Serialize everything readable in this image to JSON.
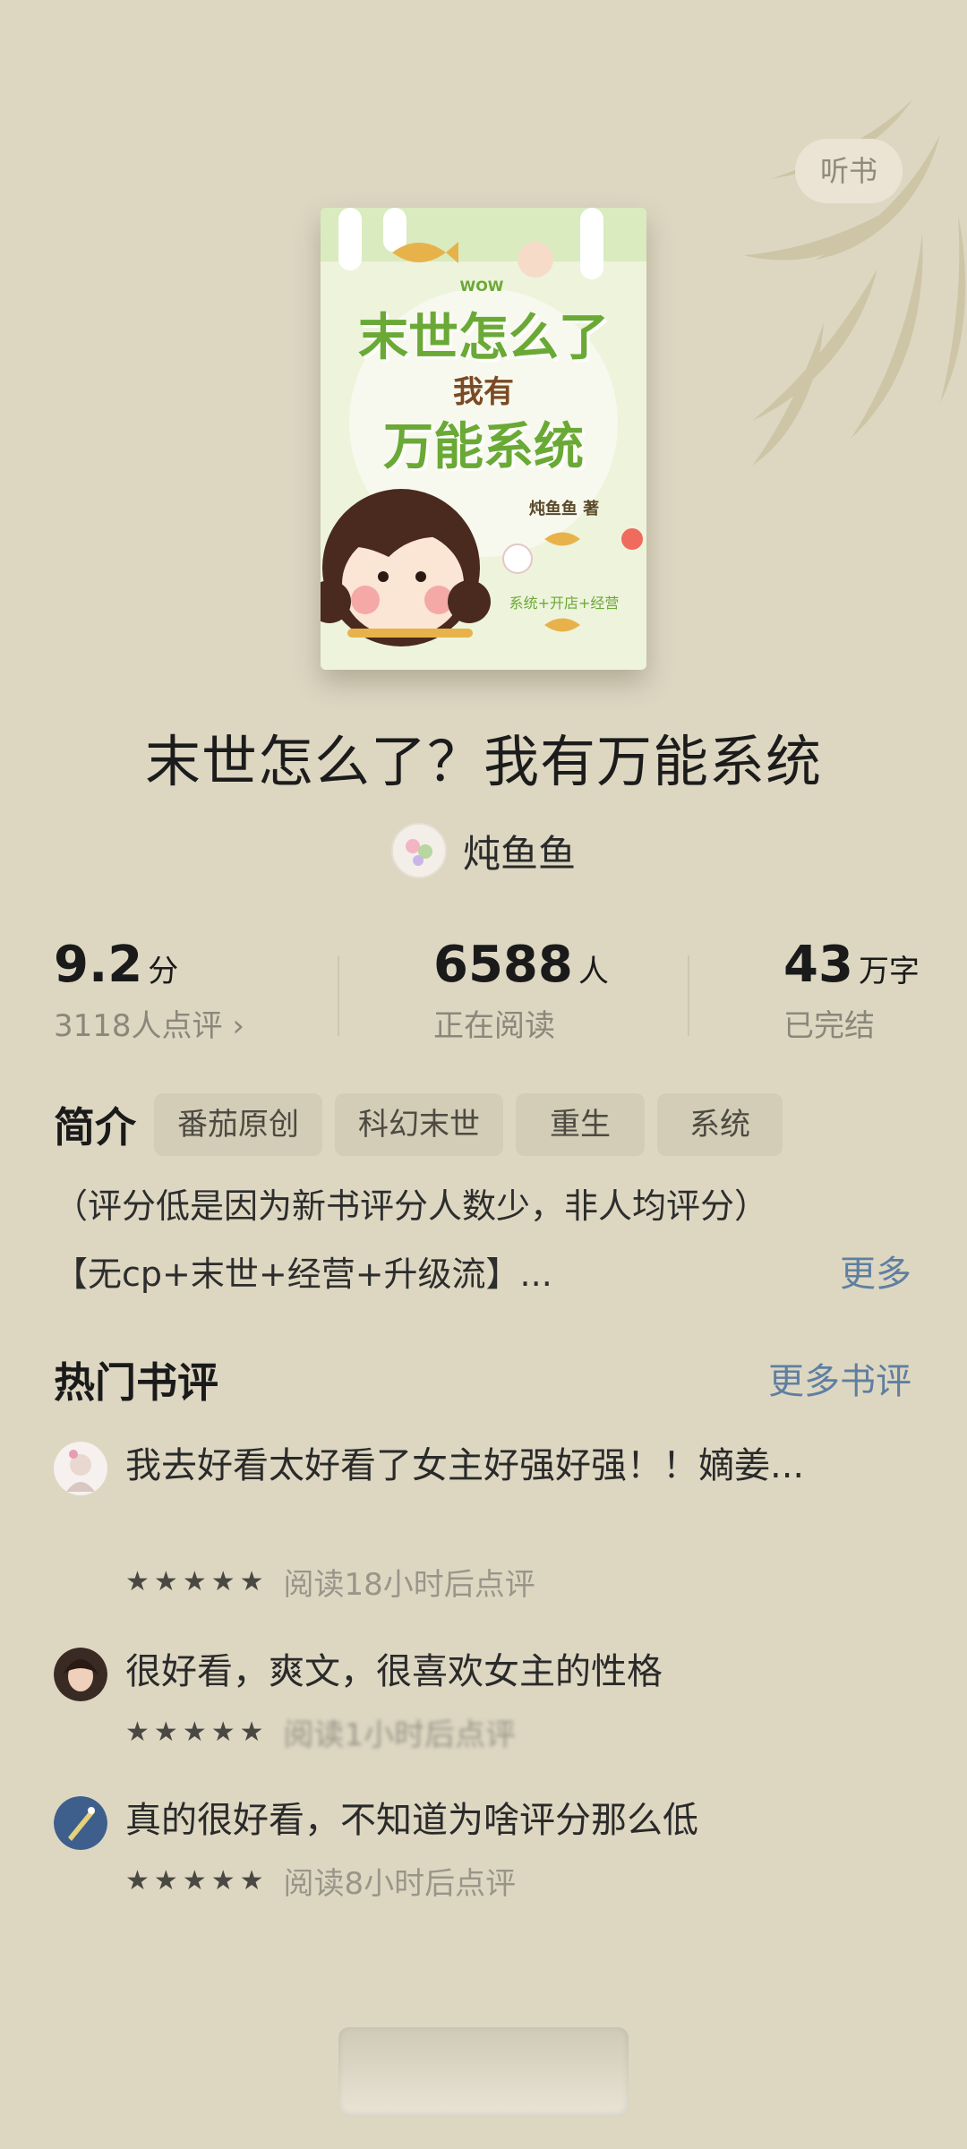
{
  "header": {
    "listen_label": "听书"
  },
  "cover": {
    "line1": "末世怎么了",
    "line2": "我有",
    "line3": "万能系统",
    "author": "炖鱼鱼 著",
    "tagline": "系统+开店+经营",
    "wow": "WOW"
  },
  "book": {
    "title": "末世怎么了？我有万能系统",
    "author": "炖鱼鱼"
  },
  "stats": {
    "rating": {
      "value": "9.2",
      "unit": "分",
      "sub": "3118人点评 ›"
    },
    "readers": {
      "value": "6588",
      "unit": "人",
      "sub": "正在阅读"
    },
    "words": {
      "value": "43",
      "unit": "万字",
      "sub": "已完结"
    }
  },
  "intro": {
    "label": "简介",
    "tags": [
      "番茄原创",
      "科幻末世",
      "重生",
      "系统"
    ],
    "line1": "（评分低是因为新书评分人数少，非人均评分）",
    "line2": "【无cp+末世+经营+升级流】...",
    "more": "更多"
  },
  "reviews": {
    "title": "热门书评",
    "more": "更多书评",
    "items": [
      {
        "text": "我去好看太好看了女主好强好强！！嫡姜...",
        "note": "阅读18小时后点评",
        "stars": 5
      },
      {
        "text": "很好看，爽文，很喜欢女主的性格",
        "note": "阅读1小时后点评",
        "stars": 5
      },
      {
        "text": "真的很好看，不知道为啥评分那么低",
        "note": "阅读8小时后点评",
        "stars": 5
      }
    ]
  },
  "colors": {
    "background": "#ddd7c2",
    "link": "#5f7fa0",
    "tag_bg": "#d3ccb6",
    "cover_green": "#78b33a"
  }
}
